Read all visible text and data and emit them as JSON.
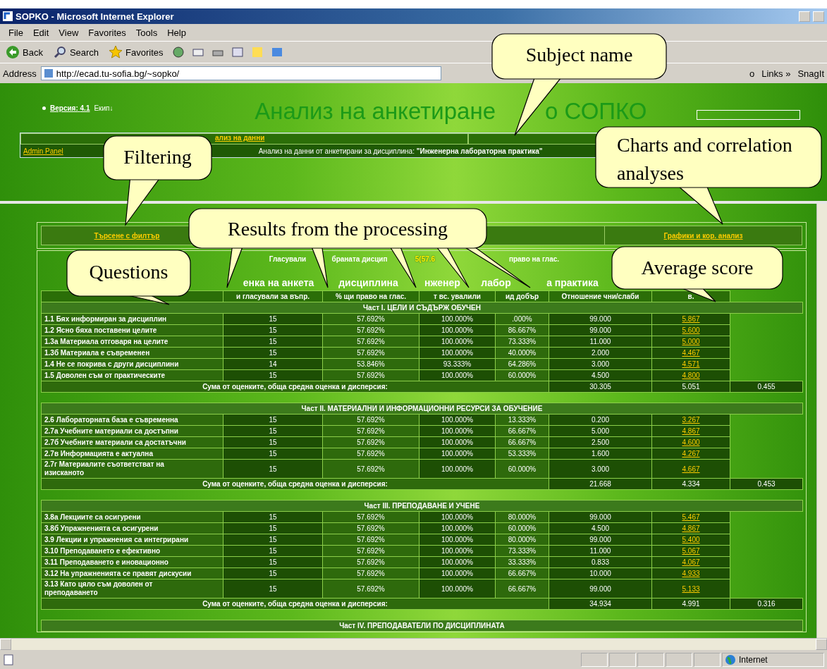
{
  "window": {
    "title": "SOPKO - Microsoft Internet Explorer"
  },
  "menu": [
    "File",
    "Edit",
    "View",
    "Favorites",
    "Tools",
    "Help"
  ],
  "toolbar": [
    {
      "kind": "back",
      "label": "Back"
    },
    {
      "kind": "search",
      "label": "Search"
    },
    {
      "kind": "favorites",
      "label": "Favorites"
    }
  ],
  "address": {
    "label": "Address",
    "value": "http://ecad.tu-sofia.bg/~sopko/"
  },
  "links_bar": {
    "go_fragment": "o",
    "links": "Links",
    "chevron": "»",
    "snagit": "SnagIt"
  },
  "page": {
    "version_label": "Версия:",
    "version": "4.1",
    "team": "Екип↓",
    "title_parts": [
      "Анализ на анкетиране",
      "о СОПКО"
    ],
    "nav_link": "ализ на данни",
    "admin_link": "Admin Panel",
    "subject_line": "Анализ на данни от анкетирани за дисциплина: **\"Инженерна лабораторна практика\"**",
    "filter_link": "Търсене с филтър",
    "charts_link": "Графики и кор. анализ",
    "voters_parts": [
      {
        "text": "Гласували",
        "highlight": false
      },
      {
        "text": "браната дисцип",
        "highlight": false
      },
      {
        "text": "5(57.6",
        "highlight": true
      },
      {
        "text": "право на глас.",
        "highlight": false
      }
    ],
    "table_title_parts": [
      "енка на анкета",
      "дисциплина",
      "нженер",
      "лабор",
      "а практика"
    ],
    "columns": [
      "и гласували за въпр.",
      "% щи право на глас.",
      "т вс. увалили",
      "ид добър",
      "Отношение чни/слаби",
      "в."
    ],
    "sections": [
      {
        "title": "Част I. ЦЕЛИ И СЪДЪРЖ ОБУЧЕН",
        "rows": [
          [
            "1.1 Бях информиран за дисциплин",
            "15",
            "57.692%",
            "100.000%",
            ".000%",
            "99.000",
            "5.867"
          ],
          [
            "1.2 Ясно бяха поставени целите",
            "15",
            "57.692%",
            "100.000%",
            "86.667%",
            "99.000",
            "5.600"
          ],
          [
            "1.3а Материала отговаря на целите",
            "15",
            "57.692%",
            "100.000%",
            "73.333%",
            "11.000",
            "5.000"
          ],
          [
            "1.3б Материала е съвременен",
            "15",
            "57.692%",
            "100.000%",
            "40.000%",
            "2.000",
            "4.467"
          ],
          [
            "1.4 Не се покрива с други дисциплини",
            "14",
            "53.846%",
            "93.333%",
            "64.286%",
            "3.000",
            "4.571"
          ],
          [
            "1.5 Доволен съм от практическите",
            "15",
            "57.692%",
            "100.000%",
            "60.000%",
            "4.500",
            "4.800"
          ]
        ],
        "summary": {
          "label": "Сума от оценките, обща средна оценка и дисперсия:",
          "sum": "30.305",
          "mean": "5.051",
          "dispersion": "0.455"
        }
      },
      {
        "title": "Част II. МАТЕРИАЛНИ И ИНФОРМАЦИОННИ РЕСУРСИ ЗА ОБУЧЕНИЕ",
        "rows": [
          [
            "2.6 Лабораторната база е съвременна",
            "15",
            "57.692%",
            "100.000%",
            "13.333%",
            "0.200",
            "3.267"
          ],
          [
            "2.7а Учебните материали са достъпни",
            "15",
            "57.692%",
            "100.000%",
            "66.667%",
            "5.000",
            "4.867"
          ],
          [
            "2.7б Учебните материали са достатъчни",
            "15",
            "57.692%",
            "100.000%",
            "66.667%",
            "2.500",
            "4.600"
          ],
          [
            "2.7в Информацията е актуална",
            "15",
            "57.692%",
            "100.000%",
            "53.333%",
            "1.600",
            "4.267"
          ],
          [
            "2.7г Материалите съответстват на изисканото",
            "15",
            "57.692%",
            "100.000%",
            "60.000%",
            "3.000",
            "4.667"
          ]
        ],
        "summary": {
          "label": "Сума от оценките, обща средна оценка и дисперсия:",
          "sum": "21.668",
          "mean": "4.334",
          "dispersion": "0.453"
        }
      },
      {
        "title": "Част III. ПРЕПОДАВАНЕ И УЧЕНЕ",
        "rows": [
          [
            "3.8а Лекциите са осигурени",
            "15",
            "57.692%",
            "100.000%",
            "80.000%",
            "99.000",
            "5.467"
          ],
          [
            "3.8б Упражненията са осигурени",
            "15",
            "57.692%",
            "100.000%",
            "60.000%",
            "4.500",
            "4.867"
          ],
          [
            "3.9 Лекции и упражнения са интегрирани",
            "15",
            "57.692%",
            "100.000%",
            "80.000%",
            "99.000",
            "5.400"
          ],
          [
            "3.10 Преподаването е ефективно",
            "15",
            "57.692%",
            "100.000%",
            "73.333%",
            "11.000",
            "5.067"
          ],
          [
            "3.11 Преподаването е иновационно",
            "15",
            "57.692%",
            "100.000%",
            "33.333%",
            "0.833",
            "4.067"
          ],
          [
            "3.12 На упражненията се правят дискусии",
            "15",
            "57.692%",
            "100.000%",
            "66.667%",
            "10.000",
            "4.933"
          ],
          [
            "3.13 Като цяло съм доволен от преподаването",
            "15",
            "57.692%",
            "100.000%",
            "66.667%",
            "99.000",
            "5.133"
          ]
        ],
        "summary": {
          "label": "Сума от оценките, обща средна оценка и дисперсия:",
          "sum": "34.934",
          "mean": "4.991",
          "dispersion": "0.316"
        }
      },
      {
        "title": "Част IV. ПРЕПОДАВАТЕЛИ ПО ДИСЦИПЛИНАТА"
      }
    ]
  },
  "callouts": [
    {
      "text": "Subject name"
    },
    {
      "text": "Filtering"
    },
    {
      "text": "Charts and correlation analyses"
    },
    {
      "text": "Results from the processing"
    },
    {
      "text": "Questions"
    },
    {
      "text": "Average score"
    }
  ],
  "status_bar": {
    "zone": "Internet"
  }
}
